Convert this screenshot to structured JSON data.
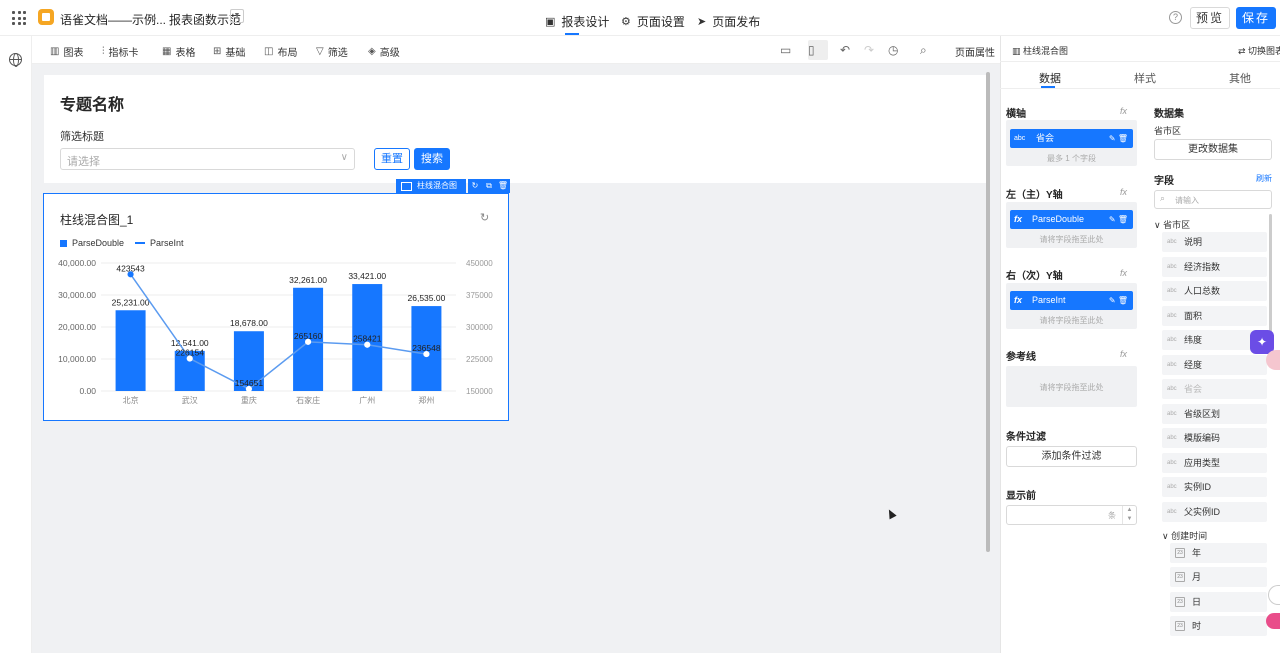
{
  "topbar": {
    "app_name": "语雀文档——示例...",
    "page_name": "报表函数示范",
    "tabs": [
      {
        "label": "报表设计",
        "icon": "report-design-icon"
      },
      {
        "label": "页面设置",
        "icon": "gear-icon"
      },
      {
        "label": "页面发布",
        "icon": "send-icon"
      }
    ],
    "preview_label": "预览",
    "save_label": "保存",
    "accent": "#1677ff"
  },
  "toolbar": {
    "items": [
      {
        "label": "图表",
        "icon": "chart-icon"
      },
      {
        "label": "指标卡",
        "icon": "kpi-icon"
      },
      {
        "label": "表格",
        "icon": "table-icon"
      },
      {
        "label": "基础",
        "icon": "basic-icon"
      },
      {
        "label": "布局",
        "icon": "layout-icon"
      },
      {
        "label": "筛选",
        "icon": "filter-icon"
      },
      {
        "label": "高级",
        "icon": "advanced-icon"
      }
    ],
    "page_props_label": "页面属性"
  },
  "canvas": {
    "page_title": "专题名称",
    "filter_label": "筛选标题",
    "select_placeholder": "请选择",
    "reset_label": "重置",
    "search_label": "搜索",
    "chart_tag_label": "柱线混合图"
  },
  "chart": {
    "title": "柱线混合图_1",
    "legend": [
      "ParseDouble",
      "ParseInt"
    ]
  },
  "chart_data": {
    "type": "bar",
    "categories": [
      "北京",
      "武汉",
      "重庆",
      "石家庄",
      "广州",
      "郑州"
    ],
    "series": [
      {
        "name": "ParseDouble",
        "type": "bar",
        "axis": "left",
        "values": [
          25231,
          12541,
          18678,
          32261,
          33421,
          26535
        ],
        "labels": [
          "25,231.00",
          "12,541.00",
          "18,678.00",
          "32,261.00",
          "33,421.00",
          "26,535.00"
        ],
        "color": "#1677ff"
      },
      {
        "name": "ParseInt",
        "type": "line",
        "axis": "right",
        "values": [
          423543,
          226154,
          154651,
          265160,
          258421,
          236548
        ],
        "labels": [
          "423543",
          "226154",
          "154651",
          "265160",
          "258421",
          "236548"
        ],
        "color": "#1677ff"
      }
    ],
    "ylim": [
      0,
      40000
    ],
    "yticks": [
      "40,000.00",
      "30,000.00",
      "20,000.00",
      "10,000.00",
      "0.00"
    ],
    "ytick_values": [
      40000,
      30000,
      20000,
      10000,
      0
    ],
    "y2lim": [
      150000,
      450000
    ],
    "y2ticks": [
      "450000",
      "375000",
      "300000",
      "225000",
      "150000"
    ],
    "y2tick_values": [
      450000,
      375000,
      300000,
      225000,
      150000
    ],
    "legend_position": "top-left",
    "grid": true
  },
  "rpanel": {
    "header_title": "柱线混合图",
    "switch_label": "切换图表",
    "tabs": [
      "数据",
      "样式",
      "其他"
    ],
    "x_axis_label": "横轴",
    "x_field": "省会",
    "x_hint": "最多 1 个字段",
    "yl_label": "左（主）Y轴",
    "yl_field": "ParseDouble",
    "yl_hint": "请将字段拖至此处",
    "yr_label": "右（次）Y轴",
    "yr_field": "ParseInt",
    "yr_hint": "请将字段拖至此处",
    "ref_label": "参考线",
    "ref_hint": "请将字段拖至此处",
    "cond_label": "条件过滤",
    "cond_btn": "添加条件过滤",
    "show_label": "显示前",
    "show_unit": "条",
    "fx": "fx",
    "abc": "abc",
    "dataset_label": "数据集",
    "dataset_name": "省市区",
    "change_dataset": "更改数据集",
    "fields_label": "字段",
    "refresh_label": "刷新",
    "search_placeholder": "请输入",
    "group1": "省市区",
    "fields": [
      "说明",
      "经济指数",
      "人口总数",
      "面积",
      "纬度",
      "经度",
      "省会",
      "省级区划",
      "模版编码",
      "应用类型",
      "实例ID",
      "父实例ID"
    ],
    "group2": "创建时间",
    "date_fields": [
      "年",
      "月",
      "日",
      "时"
    ],
    "cal_glyph": "23"
  }
}
